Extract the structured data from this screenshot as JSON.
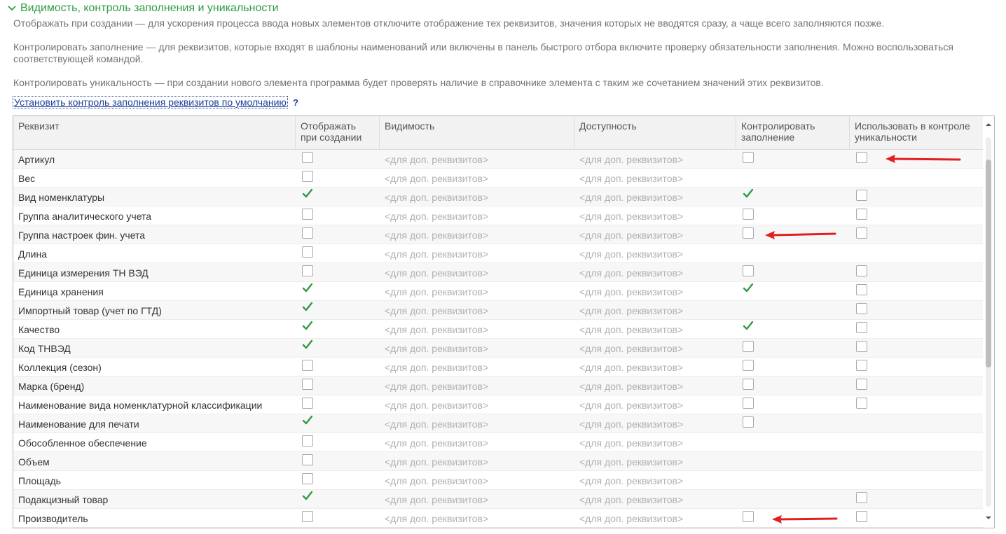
{
  "section": {
    "title": "Видимость, контроль заполнения и уникальности",
    "descriptions": [
      "Отображать при создании — для ускорения процесса ввода новых элементов отключите отображение тех реквизитов, значения которых не вводятся сразу, а чаще всего заполняются позже.",
      "Контролировать заполнение — для реквизитов, которые входят в шаблоны наименований или включены в панель быстрого отбора включите проверку обязательности заполнения. Можно воспользоваться соответствующей командой.",
      "Контролировать уникальность — при создании нового элемента программа будет проверять наличие в справочнике элемента с таким же сочетанием значений этих реквизитов."
    ],
    "default_link": "Установить контроль заполнения реквизитов по умолчанию",
    "help": "?"
  },
  "colors": {
    "accent": "#2e9b44",
    "link": "#1f3f9a",
    "arrow": "#e02020"
  },
  "table": {
    "columns": [
      "Реквизит",
      "Отображать при создании",
      "Видимость",
      "Доступность",
      "Контролировать заполнение",
      "Использовать в контроле уникальности"
    ],
    "placeholder": "<для доп. реквизитов>",
    "rows": [
      {
        "name": "Артикул",
        "show": false,
        "fill": false,
        "unique": false
      },
      {
        "name": "Вес",
        "show": false,
        "fill": null,
        "unique": null
      },
      {
        "name": "Вид номенклатуры",
        "show": true,
        "fill": true,
        "unique": false
      },
      {
        "name": "Группа аналитического учета",
        "show": false,
        "fill": false,
        "unique": false
      },
      {
        "name": "Группа настроек фин. учета",
        "show": false,
        "fill": false,
        "unique": false
      },
      {
        "name": "Длина",
        "show": false,
        "fill": null,
        "unique": null
      },
      {
        "name": "Единица измерения ТН ВЭД",
        "show": false,
        "fill": false,
        "unique": false
      },
      {
        "name": "Единица хранения",
        "show": true,
        "fill": true,
        "unique": false
      },
      {
        "name": "Импортный товар (учет по ГТД)",
        "show": true,
        "fill": null,
        "unique": false
      },
      {
        "name": "Качество",
        "show": true,
        "fill": true,
        "unique": false
      },
      {
        "name": "Код ТНВЭД",
        "show": true,
        "fill": false,
        "unique": false
      },
      {
        "name": "Коллекция (сезон)",
        "show": false,
        "fill": false,
        "unique": false
      },
      {
        "name": "Марка (бренд)",
        "show": false,
        "fill": false,
        "unique": false
      },
      {
        "name": "Наименование вида номенклатурной классификации",
        "show": false,
        "fill": false,
        "unique": false
      },
      {
        "name": "Наименование для печати",
        "show": true,
        "fill": false,
        "unique": null
      },
      {
        "name": "Обособленное обеспечение",
        "show": false,
        "fill": null,
        "unique": null
      },
      {
        "name": "Объем",
        "show": false,
        "fill": null,
        "unique": null
      },
      {
        "name": "Площадь",
        "show": false,
        "fill": null,
        "unique": null
      },
      {
        "name": "Подакцизный товар",
        "show": true,
        "fill": null,
        "unique": false
      },
      {
        "name": "Производитель",
        "show": false,
        "fill": false,
        "unique": false
      }
    ]
  },
  "annotation_icons": [
    "red-arrow-icon",
    "red-arrow-icon",
    "red-arrow-icon"
  ]
}
